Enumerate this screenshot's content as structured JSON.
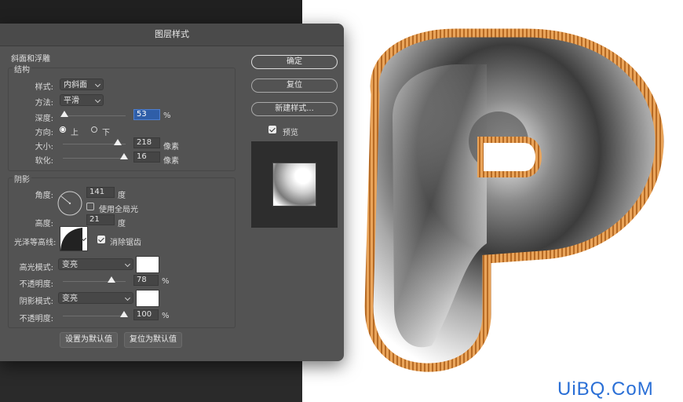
{
  "dialog": {
    "title": "图层样式",
    "section_bevel": "斜面和浮雕",
    "structure": {
      "legend": "结构",
      "style_label": "样式:",
      "style_value": "内斜面",
      "technique_label": "方法:",
      "technique_value": "平滑",
      "depth_label": "深度:",
      "depth_value": "53",
      "depth_unit": "%",
      "direction_label": "方向:",
      "direction_up": "上",
      "direction_down": "下",
      "size_label": "大小:",
      "size_value": "218",
      "size_unit": "像素",
      "soften_label": "软化:",
      "soften_value": "16",
      "soften_unit": "像素"
    },
    "shading": {
      "legend": "阴影",
      "angle_label": "角度:",
      "angle_value": "141",
      "angle_unit": "度",
      "global_light_label": "使用全局光",
      "altitude_label": "高度:",
      "altitude_value": "21",
      "altitude_unit": "度",
      "gloss_contour_label": "光泽等高线:",
      "anti_aliased_label": "消除锯齿",
      "highlight_mode_label": "高光模式:",
      "highlight_mode_value": "变亮",
      "highlight_opacity_label": "不透明度:",
      "highlight_opacity_value": "78",
      "highlight_opacity_unit": "%",
      "shadow_mode_label": "阴影模式:",
      "shadow_mode_value": "变亮",
      "shadow_opacity_label": "不透明度:",
      "shadow_opacity_value": "100",
      "shadow_opacity_unit": "%"
    },
    "make_default": "设置为默认值",
    "reset_default": "复位为默认值",
    "ok": "确定",
    "reset": "复位",
    "new_style": "新建样式...",
    "preview_label": "预览"
  },
  "watermark": "UiBQ.CoM",
  "colors": {
    "panel": "#535353",
    "selection": "#2f5ea8",
    "outline_gold": "#d88d3c",
    "watermark": "#2a6fd6"
  }
}
